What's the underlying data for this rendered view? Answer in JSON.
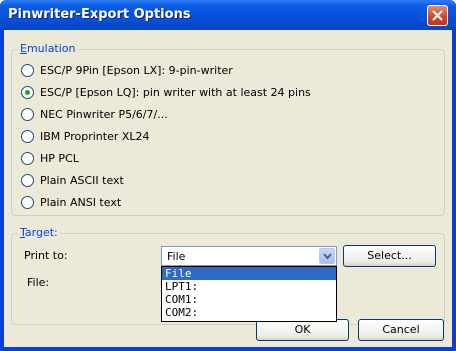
{
  "window": {
    "title": "Pinwriter-Export Options"
  },
  "emulation": {
    "legend_underlined": "E",
    "legend_rest": "mulation",
    "options": [
      {
        "label": "ESC/P 9Pin [Epson LX]: 9-pin-writer",
        "checked": false
      },
      {
        "label": "ESC/P [Epson LQ]: pin writer with at least 24 pins",
        "checked": true
      },
      {
        "label": "NEC Pinwriter P5/6/7/...",
        "checked": false
      },
      {
        "label": "IBM Proprinter XL24",
        "checked": false
      },
      {
        "label": "HP PCL",
        "checked": false
      },
      {
        "label": "Plain ASCII text",
        "checked": false
      },
      {
        "label": "Plain ANSI text",
        "checked": false
      }
    ]
  },
  "target": {
    "legend_underlined": "T",
    "legend_rest": "arget:",
    "print_to_label": "Print to:",
    "print_to_value": "File",
    "select_button": "Select...",
    "file_label": "File:",
    "dropdown_options": [
      "File",
      "LPT1:",
      "COM1:",
      "COM2:"
    ],
    "selected_index": 0
  },
  "footer": {
    "ok_button": "OK",
    "cancel_button": "Cancel"
  },
  "colors": {
    "titlebar": "#0850d8",
    "dialog_bg": "#ece9d8",
    "legend_text": "#0046d5",
    "selection": "#316ac5",
    "radio_dot": "#21a121",
    "close_button": "#d6472a"
  }
}
